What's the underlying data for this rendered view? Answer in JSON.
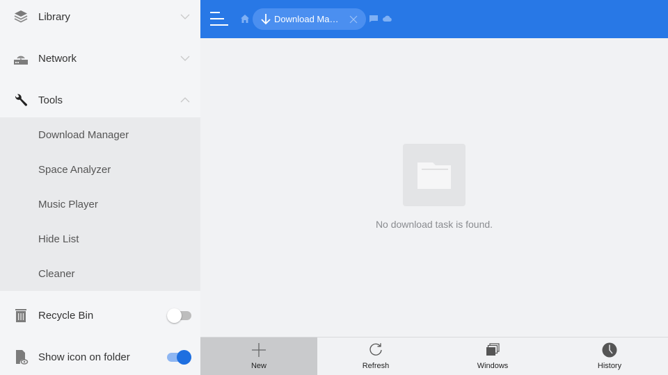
{
  "sidebar": {
    "items": [
      {
        "label": "Library",
        "icon": "layers-icon",
        "expanded": false
      },
      {
        "label": "Network",
        "icon": "router-icon",
        "expanded": false
      },
      {
        "label": "Tools",
        "icon": "wrench-icon",
        "expanded": true
      }
    ],
    "tools_subitems": [
      {
        "label": "Download Manager"
      },
      {
        "label": "Space Analyzer"
      },
      {
        "label": "Music Player"
      },
      {
        "label": "Hide List"
      },
      {
        "label": "Cleaner"
      }
    ],
    "toggles": [
      {
        "label": "Recycle Bin",
        "icon": "trash-icon",
        "on": false
      },
      {
        "label": "Show icon on folder",
        "icon": "file-eye-icon",
        "on": true
      }
    ]
  },
  "header": {
    "tab_label": "Download Ma…",
    "tab_icon": "download-arrow-icon",
    "accent_color": "#2878e6"
  },
  "main": {
    "empty_message": "No download task is found."
  },
  "bottom_bar": {
    "buttons": [
      {
        "label": "New",
        "icon": "plus-icon",
        "active": true
      },
      {
        "label": "Refresh",
        "icon": "refresh-icon",
        "active": false
      },
      {
        "label": "Windows",
        "icon": "windows-stack-icon",
        "active": false
      },
      {
        "label": "History",
        "icon": "clock-icon",
        "active": false
      }
    ]
  }
}
